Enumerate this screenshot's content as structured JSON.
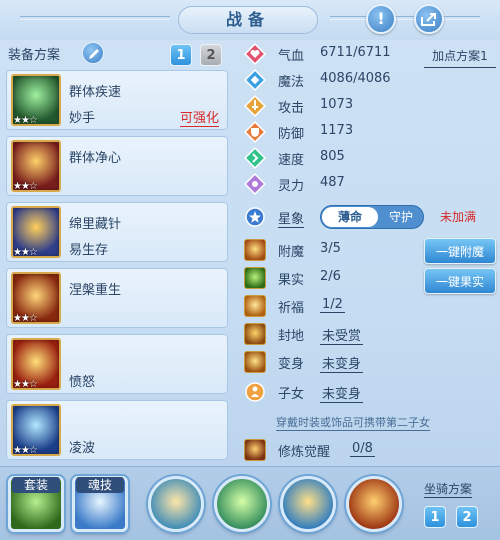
{
  "header": {
    "title": "战备"
  },
  "left": {
    "heading": "装备方案",
    "pages": [
      "1",
      "2"
    ],
    "slots": [
      {
        "name1": "群体疾速",
        "name2": "妙手",
        "badge": "可强化",
        "stars": "★★☆"
      },
      {
        "name1": "群体净心",
        "name2": "",
        "badge": "",
        "stars": "★★☆"
      },
      {
        "name1": "绵里藏针",
        "name2": "易生存",
        "badge": "",
        "stars": "★★☆"
      },
      {
        "name1": "涅槃重生",
        "name2": "",
        "badge": "",
        "stars": "★★☆"
      },
      {
        "name1": "",
        "name2": "愤怒",
        "badge": "",
        "stars": "★★☆"
      },
      {
        "name1": "",
        "name2": "凌波",
        "badge": "",
        "stars": "★★☆"
      }
    ]
  },
  "stats": {
    "plan_label": "加点方案1",
    "rows": [
      {
        "label": "气血",
        "value": "6711/6711",
        "color": "#e0526e"
      },
      {
        "label": "魔法",
        "value": "4086/4086",
        "color": "#3aa0e0"
      },
      {
        "label": "攻击",
        "value": "1073",
        "color": "#e8a23a"
      },
      {
        "label": "防御",
        "value": "1173",
        "color": "#e87a3a"
      },
      {
        "label": "速度",
        "value": "805",
        "color": "#2fc28a"
      },
      {
        "label": "灵力",
        "value": "487",
        "color": "#b07ad8"
      }
    ],
    "star_label": "星象",
    "toggle_on": "薄命",
    "toggle_off": "守护",
    "star_status": "未加满"
  },
  "extras": {
    "rows": [
      {
        "label": "附魔",
        "value": "3/5"
      },
      {
        "label": "果实",
        "value": "2/6"
      },
      {
        "label": "祈福",
        "value": "1/2"
      },
      {
        "label": "封地",
        "value": "未受赏"
      },
      {
        "label": "变身",
        "value": "未变身"
      },
      {
        "label": "子女",
        "value": "未变身"
      }
    ],
    "btn_enchant": "一键附魔",
    "btn_fruit": "一键果实",
    "hint": "穿戴时装或饰品可携带第二子女",
    "awaken_label": "修炼觉醒",
    "awaken_value": "0/8"
  },
  "bottom": {
    "tag_equip": "套装",
    "tag_soul": "魂技",
    "mount_label": "坐骑方案",
    "mount_pages": [
      "1",
      "2"
    ]
  }
}
